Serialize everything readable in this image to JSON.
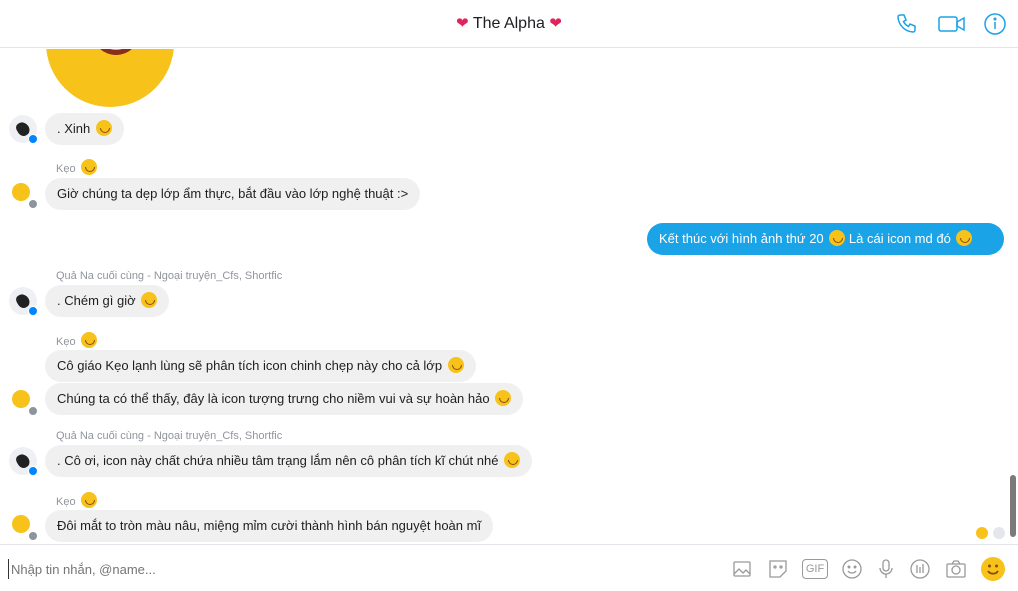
{
  "header": {
    "title": "The Alpha",
    "heart_left": "❤",
    "heart_right": "❤",
    "icons": [
      "phone-icon",
      "video-camera-icon",
      "info-icon"
    ],
    "accent_color": "#1aa3e6"
  },
  "messages": [
    {
      "sender": "",
      "text": ". Xinh"
    },
    {
      "sender": "Kẹo",
      "text": "Giờ chúng ta dẹp lớp ẩm thực, bắt đầu vào lớp nghệ thuật :>"
    },
    {
      "sender": "",
      "text": "Kết thúc với hình ảnh thứ 20",
      "text2": "Là cái icon md đó"
    },
    {
      "sender": "Quả Na cuối cùng - Ngoại truyện_Cfs, Shortfic",
      "text": ". Chém gì giờ"
    },
    {
      "sender": "Kẹo",
      "text": "Cô giáo Kẹo lạnh lùng sẽ phân tích icon chinh chẹp này cho cả lớp"
    },
    {
      "sender": "",
      "text": "Chúng ta có thể thấy, đây là icon tượng trưng cho niềm vui và sự hoàn hảo"
    },
    {
      "sender": "Quả Na cuối cùng - Ngoại truyện_Cfs, Shortfic",
      "text": ". Cô ơi, icon này chất chứa nhiều tâm trạng lắm nên cô phân tích kĩ chút nhé"
    },
    {
      "sender": "Kẹo",
      "text": "Đôi mắt to tròn màu nâu, miệng mỉm cười thành hình bán nguyệt hoàn mĩ"
    }
  ],
  "composer": {
    "placeholder": "Nhập tin nhắn, @name...",
    "icons": [
      "image-icon",
      "sticker-icon",
      "gif-icon",
      "emoji-icon",
      "microphone-icon",
      "poll-icon",
      "camera-icon",
      "like-emoji-icon"
    ],
    "gif_label": "GIF"
  }
}
